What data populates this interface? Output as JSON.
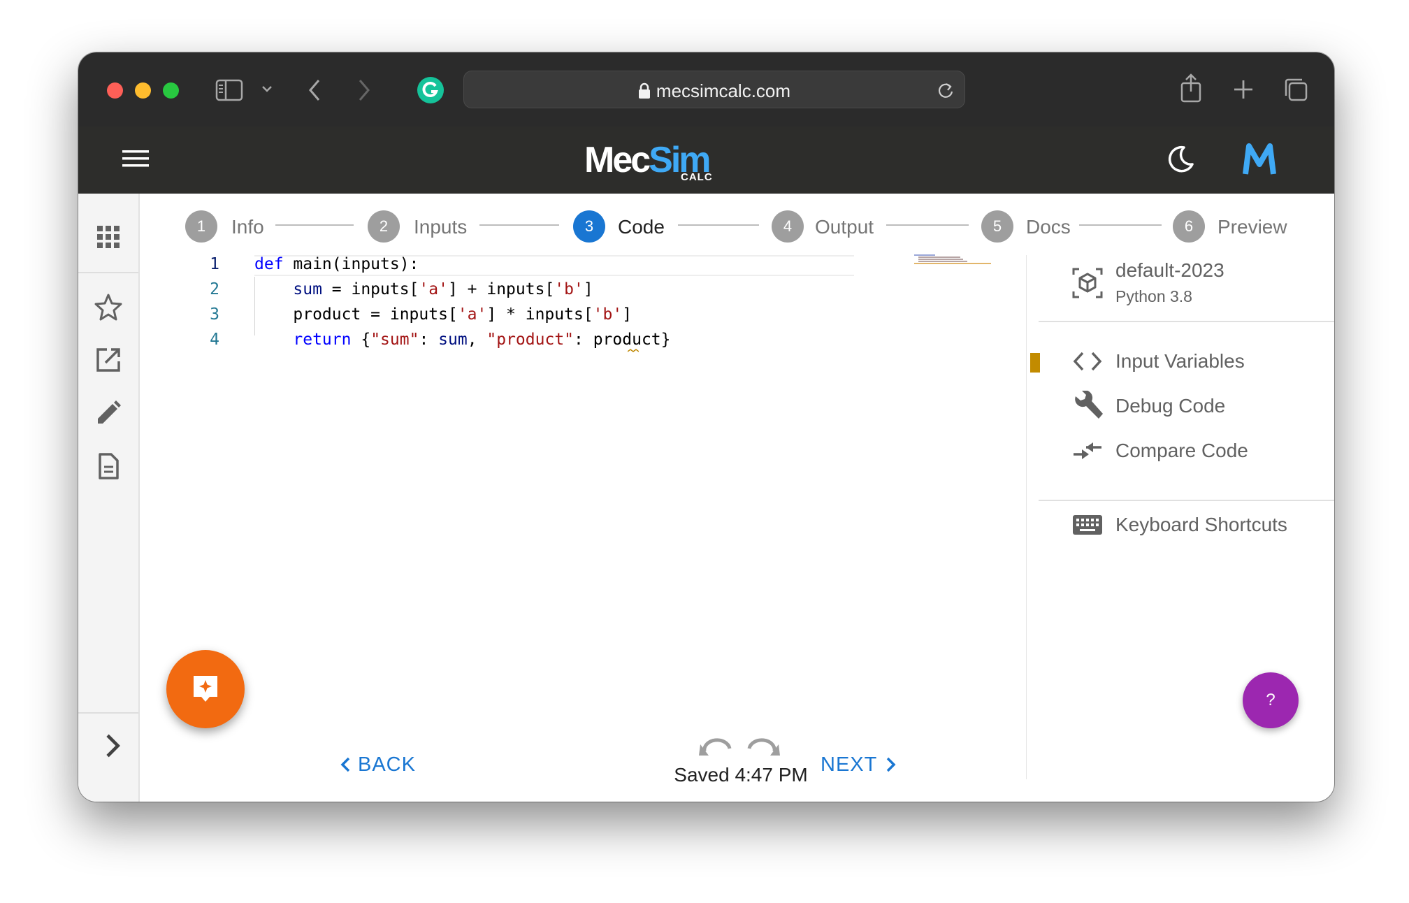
{
  "browser": {
    "url": "mecsimcalc.com"
  },
  "header": {
    "logo_main_a": "Mec",
    "logo_main_b": "Sim",
    "logo_sub": "CALC"
  },
  "stepper": {
    "steps": [
      {
        "number": "1",
        "label": "Info"
      },
      {
        "number": "2",
        "label": "Inputs"
      },
      {
        "number": "3",
        "label": "Code",
        "active": true
      },
      {
        "number": "4",
        "label": "Output"
      },
      {
        "number": "5",
        "label": "Docs"
      },
      {
        "number": "6",
        "label": "Preview"
      }
    ]
  },
  "editor": {
    "line_numbers": [
      "1",
      "2",
      "3",
      "4"
    ],
    "lines": [
      "def main(inputs):",
      "    sum = inputs['a'] + inputs['b']",
      "    product = inputs['a'] * inputs['b']",
      "    return {\"sum\": sum, \"product\": product}"
    ]
  },
  "right_panel": {
    "environment_name": "default-2023",
    "environment_version": "Python 3.8",
    "tools": [
      "Input Variables",
      "Debug Code",
      "Compare Code"
    ],
    "shortcuts": "Keyboard Shortcuts"
  },
  "footer": {
    "back": "BACK",
    "next": "NEXT",
    "saved": "Saved 4:47 PM",
    "help": "?"
  },
  "colors": {
    "accent": "#1976d2",
    "fab": "#f26a11",
    "help": "#9c27b0",
    "header_bg": "#2d2d2b"
  }
}
